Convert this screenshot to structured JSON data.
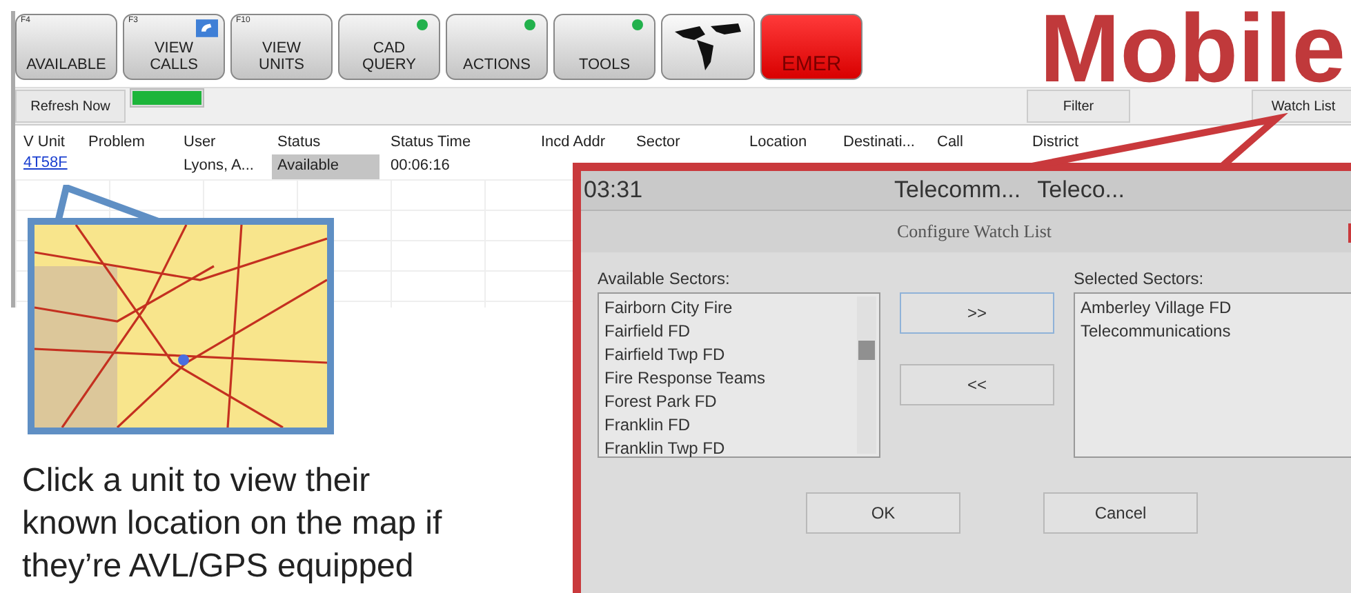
{
  "toolbar": {
    "buttons": [
      {
        "fkey": "F4",
        "lines": [
          "AVAILABLE"
        ],
        "kind": "plain"
      },
      {
        "fkey": "F3",
        "lines": [
          "VIEW",
          "CALLS"
        ],
        "kind": "phone"
      },
      {
        "fkey": "F10",
        "lines": [
          "VIEW",
          "UNITS"
        ],
        "kind": "plain"
      },
      {
        "lines": [
          "CAD",
          "QUERY"
        ],
        "kind": "indicator"
      },
      {
        "lines": [
          "ACTIONS"
        ],
        "kind": "indicator"
      },
      {
        "lines": [
          "TOOLS"
        ],
        "kind": "indicator"
      },
      {
        "kind": "globe"
      },
      {
        "lines": [
          "EMER"
        ],
        "kind": "emergency"
      }
    ]
  },
  "refresh_button": "Refresh Now",
  "refresh_progress": {
    "level": 1
  },
  "filter_button": "Filter",
  "watch_list_button": "Watch List",
  "table": {
    "columns": [
      "V Unit",
      "Problem",
      "User",
      "Status",
      "Status Time",
      "Incd Addr",
      "Sector",
      "Location",
      "Destinati...",
      "Call",
      "District"
    ],
    "rows": [
      {
        "unit": "4T58F",
        "user": "Lyons, A...",
        "status": "Available",
        "status_time": "00:06:16"
      }
    ]
  },
  "title": "Mobile",
  "caption": "Click a unit to view their known location on the map if they’re AVL/GPS equipped",
  "dialog": {
    "clock": "03:31",
    "header_cells": [
      "Telecomm...",
      "Teleco..."
    ],
    "title": "Configure Watch List",
    "available_label": "Available Sectors:",
    "available": [
      "Fairborn City Fire",
      "Fairfield FD",
      "Fairfield Twp FD",
      "Fire Response Teams",
      "Forest Park FD",
      "Franklin FD",
      "Franklin Twp FD"
    ],
    "add_button": ">>",
    "remove_button": "<<",
    "selected_label": "Selected Sectors:",
    "selected": [
      "Amberley Village FD",
      "Telecommunications"
    ],
    "ok_button": "OK",
    "cancel_button": "Cancel"
  }
}
